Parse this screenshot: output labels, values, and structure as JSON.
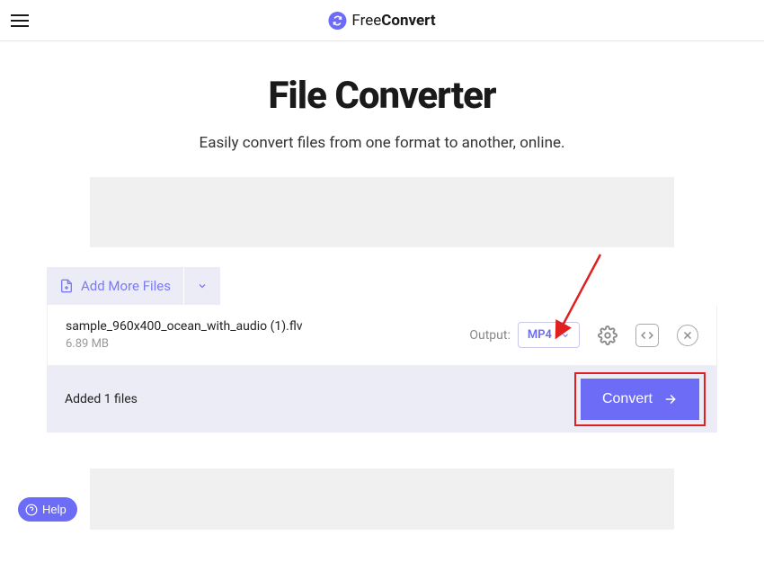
{
  "brand": {
    "free": "Free",
    "convert": "Convert"
  },
  "main": {
    "title": "File Converter",
    "subtitle": "Easily convert files from one format to another, online."
  },
  "toolbar": {
    "add_more_label": "Add More Files"
  },
  "file": {
    "name": "sample_960x400_ocean_with_audio (1).flv",
    "size": "6.89 MB",
    "output_label": "Output:",
    "format": "MP4"
  },
  "footer": {
    "status": "Added 1 files",
    "convert_label": "Convert"
  },
  "help": {
    "label": "Help"
  }
}
